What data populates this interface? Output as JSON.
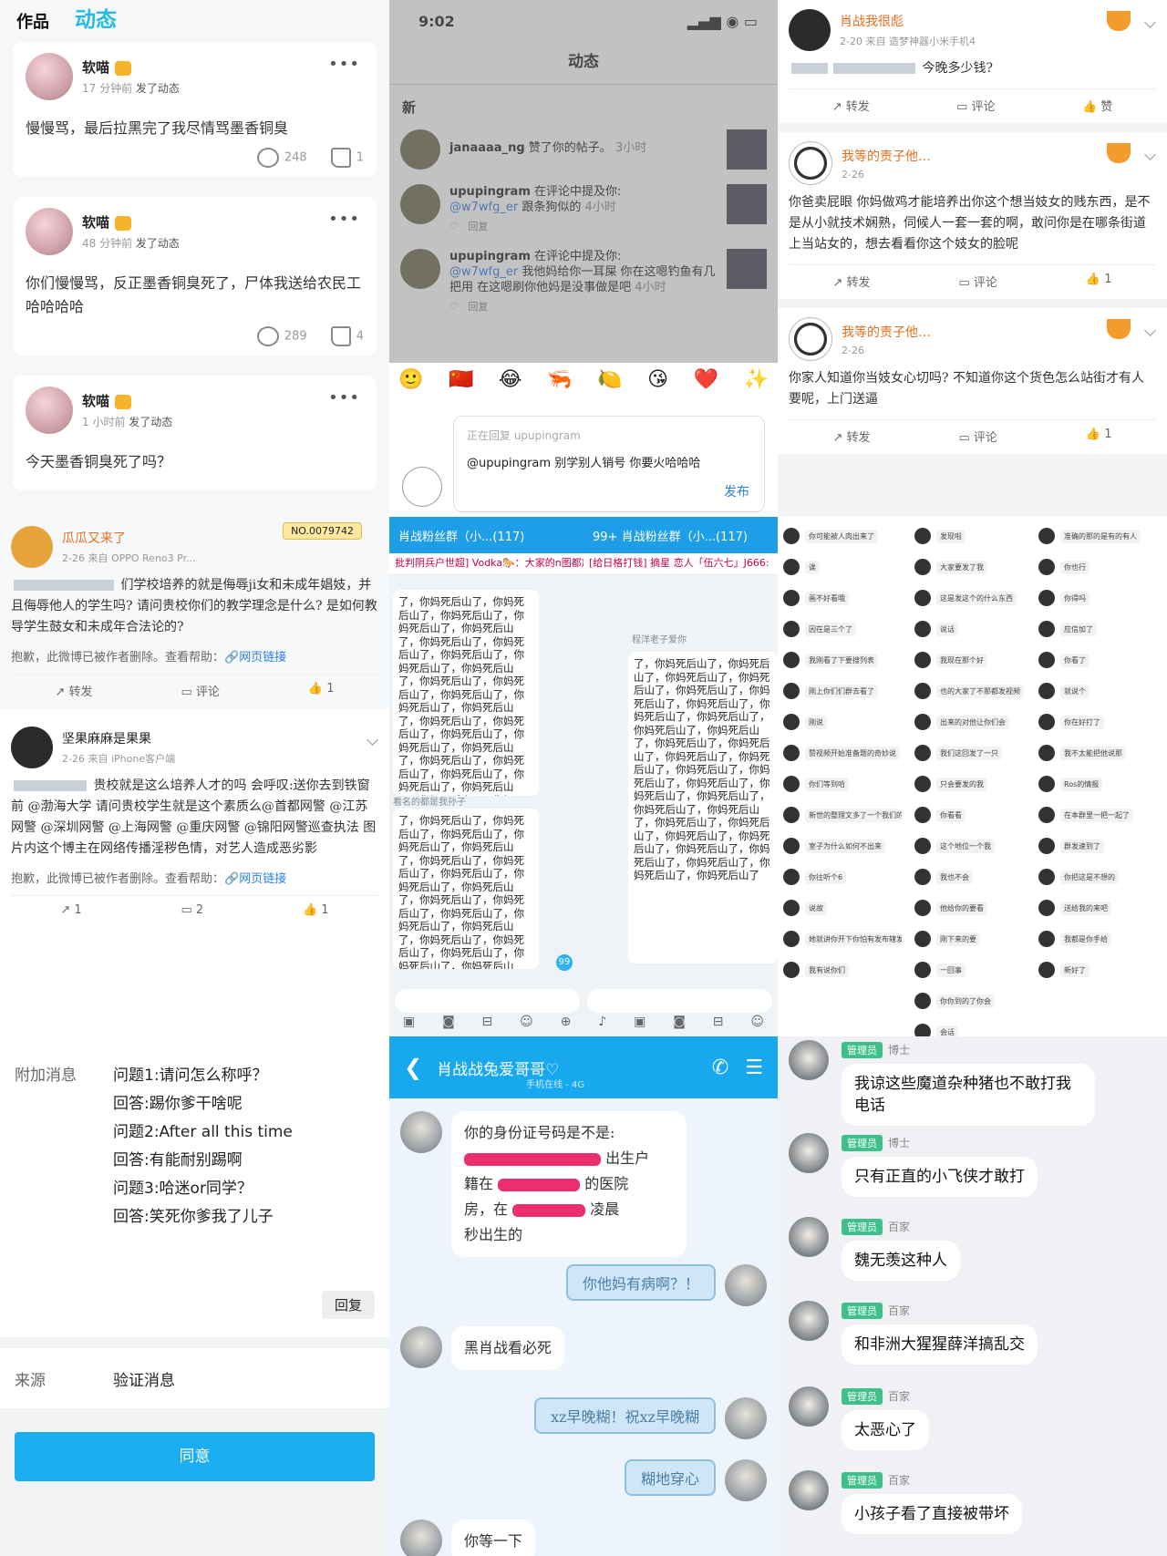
{
  "tile_tl": {
    "tabs": [
      "作品",
      "动态"
    ],
    "posts": [
      {
        "name": "软喵",
        "time": "17 分钟前",
        "action": "发了动态",
        "text": "慢慢骂，最后拉黑完了我尽情骂墨香铜臭",
        "comments": "248",
        "likes": "1"
      },
      {
        "name": "软喵",
        "time": "48 分钟前",
        "action": "发了动态",
        "text": "你们慢慢骂，反正墨香铜臭死了，尸体我送给农民工哈哈哈哈",
        "comments": "289",
        "likes": "4"
      },
      {
        "name": "软喵",
        "time": "1 小时前",
        "action": "发了动态",
        "text": "今天墨香铜臭死了吗？"
      }
    ]
  },
  "tile_tm": {
    "clock": "9:02",
    "title": "动态",
    "section": "新",
    "notifications": [
      {
        "user": "janaaaa_ng",
        "text": "赞了你的帖子。",
        "time": "3小时"
      },
      {
        "user": "upupingram",
        "text": "在评论中提及你:",
        "mention": "@w7wfg_er",
        "body": "跟条狗似的",
        "time": "4小时",
        "reply": "回复"
      },
      {
        "user": "upupingram",
        "text": "在评论中提及你:",
        "mention": "@w7wfg_er",
        "body": "我他妈给你一耳屎 你在这嗯钓鱼有几把用 在这嗯刷你他妈是没事做是吧",
        "time": "4小时",
        "reply": "回复"
      }
    ],
    "emojis": [
      "🙂",
      "🇨🇳",
      "😂",
      "🦐",
      "🍋",
      "😘",
      "❤️",
      "✨"
    ],
    "reply_placeholder": "正在回复 upupingram",
    "reply_text": "@upupingram 别学别人销号 你要火哈哈哈",
    "send": "发布"
  },
  "tile_tr": {
    "posts": [
      {
        "name": "肖战我很彪",
        "meta": "2-20 来自 造梦神器小米手机4",
        "text": "今晚多少钱?",
        "repost": "转发",
        "comment": "评论",
        "like": "赞"
      },
      {
        "name": "我等的责子他…",
        "meta": "2-26",
        "text": "你爸卖屁眼 你妈做鸡才能培养出你这个想当妓女的贱东西，是不是从小就技术娴熟，伺候人一套一套的啊，敢问你是在哪条街道上当站女的，想去看看你这个妓女的脸呢",
        "repost": "转发",
        "comment": "评论",
        "like": "1"
      },
      {
        "name": "我等的责子他…",
        "meta": "2-26",
        "text": "你家人知道你当妓女心切吗? 不知道你这个货色怎么站街才有人要呢，上门送逼",
        "repost": "转发",
        "comment": "评论",
        "like": "1"
      }
    ]
  },
  "tile_ml": {
    "posts": [
      {
        "name": "瓜瓜又来了",
        "meta": "2-26 来自 OPPO Reno3 Pr...",
        "no": "NO.0079742",
        "text": "们学校培养的就是侮辱ji女和未成年娼妓，并且侮辱他人的学生吗? 请问贵校你们的教学理念是什么? 是如何教导学生鼓女和未成年合法论的?",
        "deleted": "抱歉，此微博已被作者删除。查看帮助：",
        "link": "网页链接",
        "repost": "转发",
        "comment": "评论",
        "like": "1"
      },
      {
        "name": "坚果麻麻是果果",
        "meta": "2-26 来自 iPhone客户端",
        "text": "贵校就是这么培养人才的吗 会呼叹:送你去到铁窗前 @渤海大学 请问贵校学生就是这个素质么@首都网警 @江苏网警 @深圳网警 @上海网警 @重庆网警 @锦阳网警巡查执法 图片内这个博主在网络传播淫秽色情，对艺人造成恶劣影",
        "deleted": "抱歉，此微博已被作者删除。查看帮助：",
        "link": "网页链接",
        "repost": "1",
        "comment": "2",
        "like": "1"
      }
    ]
  },
  "tile_mm": {
    "group_title": "肖战粉丝群（小...(117)",
    "badge": "99+",
    "notice_left": "批判阴兵户世超] Vodka🐎：大家的n图都放出",
    "notice_right": "[给日格打钱] 摘星 恋人「伍六七」J666:",
    "spam_text": "了，你妈死后山了，你妈死后山了，你妈死后山了，你妈死后山了，你妈死后山了，你妈死后山了，你妈死后山了，你妈死后山了，你妈死后山了，你妈死后山了，你妈死后山了，你妈死后山了，你妈死后山了，你妈死后山了，你妈死后山了，你妈死后山了，你妈死后山了，你妈死后山了，你妈死后山了，你妈死后山了，你妈死后山了，你妈死后山了，你妈死后山了，你妈死后山了，你妈死后山了，你妈死后山了，你妈死后山了，你妈死后山了，你妈死后山了，你妈死后山了，你妈死后山了",
    "nick_a": "程洋老子爱你",
    "nick_b": "看名的都是我孙子",
    "unread": "99"
  },
  "tile_mr": {
    "col1": [
      "你可能被人肉出来了",
      "诶",
      "画不好看哦",
      "因在是三个了",
      "我刚看了下要搜列表",
      "刚上你们们群去看了",
      "刚说",
      "赞视频开始准备题的奇妙说",
      "你们等到哈",
      "新世的整理文多了一个我们的内部",
      "室子为什么如何不出来",
      "你往听个6",
      "说故",
      "她就讲你开下你怕有发布辖发速",
      "我有说你们"
    ],
    "col2": [
      "发现啦",
      "大家要发了我",
      "这是发这个的什么东西",
      "说话",
      "我现在那个好",
      "也的大家了不那都发视频",
      "出来的对他让你们会",
      "我们这回发了一只",
      "只会要发的我",
      "你看看",
      "这个地位一个我",
      "我也不会",
      "他给你的要看",
      "刚下来的要",
      "一回事",
      "你你到的了你会",
      "会话"
    ],
    "col3": [
      "准确的那的是有的有人",
      "你也行",
      "你得吗",
      "应信加了",
      "你看了",
      "就说个",
      "你在好打了",
      "我不太能把他说那",
      "Ros的情报",
      "在本群里一把一起了",
      "群发速到了",
      "你把这是不想的",
      "送给我的来吧",
      "我都是你手给",
      "新好了"
    ]
  },
  "tile_bl": {
    "label": "附加消息",
    "qa": [
      "问题1:请问怎么称呼？",
      "回答:踢你爹干啥呢",
      "问题2:After all this time",
      "回答:有能耐别踢啊",
      "问题3:哈迷or同学？",
      "回答:笑死你爹我了儿子"
    ],
    "reply": "回复",
    "source_key": "来源",
    "source_val": "验证消息",
    "agree": "同意"
  },
  "tile_bm": {
    "title": "肖战战兔爱哥哥♡",
    "subtitle": "手机在线 - 4G",
    "msg1": [
      "你的身份证号码是不是:",
      "出生户",
      "籍在",
      "的医院",
      "房，在",
      "凌晨",
      "秒出生的"
    ],
    "sticker1": "你他妈有病啊？！",
    "msg2": "黑肖战看必死",
    "sticker2": "xz早晚糊！祝xz早晚糊",
    "sticker3": "糊地穿心",
    "msg3": "你等一下"
  },
  "tile_br": {
    "top_role": "博士",
    "first_msg": "我谅这些魔道杂种猪也不敢打我电话",
    "messages": [
      {
        "tag": "管理员",
        "role": "博士",
        "text": "只有正直的小飞侠才敢打"
      },
      {
        "tag": "管理员",
        "role": "百家",
        "text": "魏无羡这种人"
      },
      {
        "tag": "管理员",
        "role": "百家",
        "text": "和非洲大猩猩薛洋搞乱交"
      },
      {
        "tag": "管理员",
        "role": "百家",
        "text": "太恶心了"
      },
      {
        "tag": "管理员",
        "role": "百家",
        "text": "小孩子看了直接被带坏"
      }
    ]
  }
}
